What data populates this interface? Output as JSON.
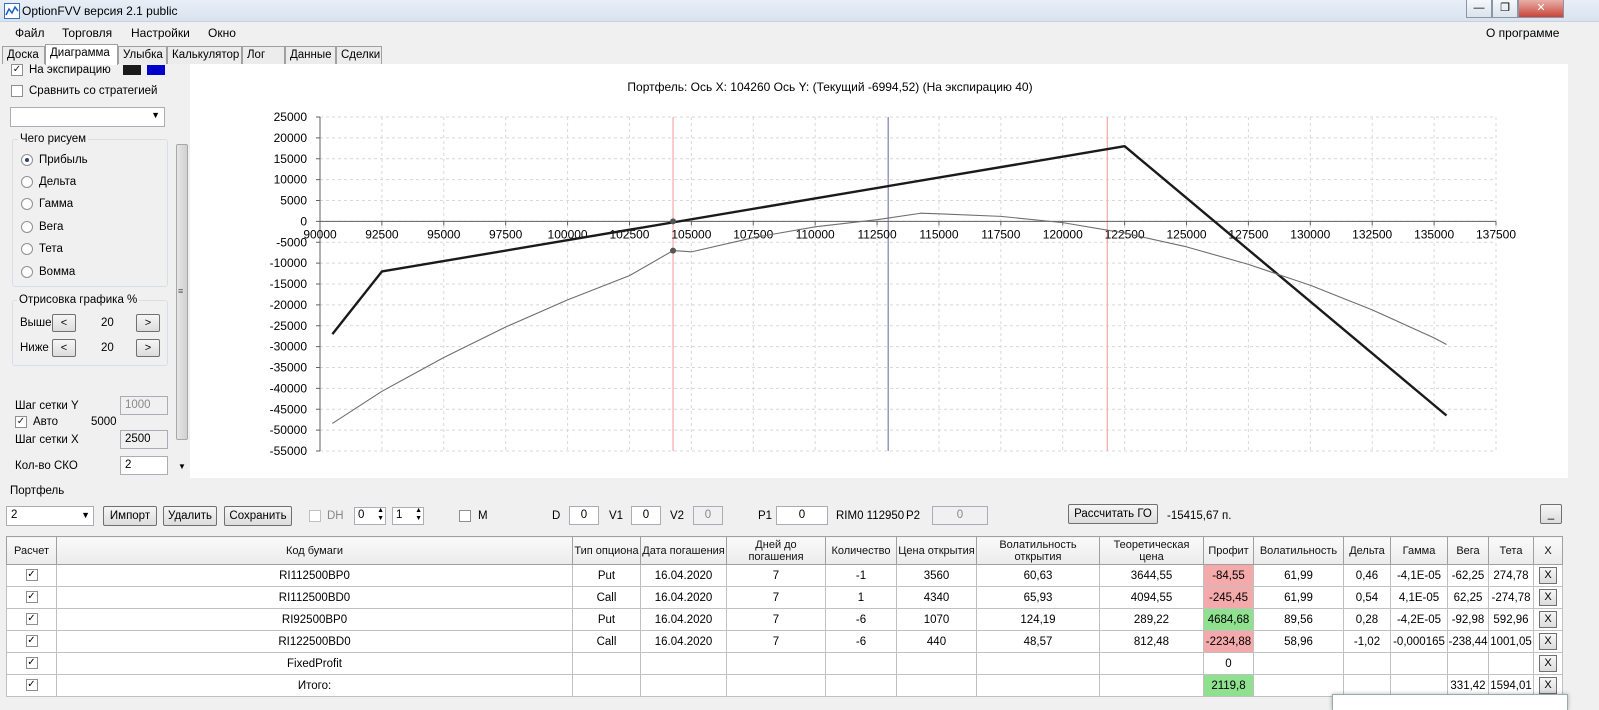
{
  "window": {
    "title": "OptionFVV версия 2.1 public"
  },
  "menu": {
    "items": [
      "Файл",
      "Торговля",
      "Настройки",
      "Окно"
    ],
    "about": "О программе"
  },
  "tabs": [
    "Доска",
    "Диаграмма",
    "Улыбка",
    "Калькулятор",
    "Лог",
    "Данные",
    "Сделки"
  ],
  "left": {
    "expiry_label": "На экспирацию",
    "compare_label": "Сравнить со стратегией",
    "what_title": "Чего рисуем",
    "radios": [
      "Прибыль",
      "Дельта",
      "Гамма",
      "Вега",
      "Тета",
      "Вомма"
    ],
    "render_title": "Отрисовка графика %",
    "above_label": "Выше",
    "above_value": "20",
    "below_label": "Ниже",
    "below_value": "20",
    "step_y_label": "Шаг сетки Y",
    "step_y_value": "1000",
    "auto_label": "Авто",
    "auto_value": "5000",
    "step_x_label": "Шаг сетки X",
    "step_x_value": "2500",
    "sko_label": "Кол-во СКО",
    "sko_value": "2",
    "swatch_colors": [
      "#1a1a1a",
      "#0000cc"
    ]
  },
  "plot": {
    "header": "Портфель:  Ось X:  104260  Ось Y:    (Текущий -6994,52)   (На экспирацию 40)"
  },
  "chart_data": {
    "type": "line",
    "x_ticks": [
      "90000",
      "92500",
      "95000",
      "97500",
      "100000",
      "102500",
      "105000",
      "107500",
      "110000",
      "112500",
      "115000",
      "117500",
      "120000",
      "122500",
      "125000",
      "127500",
      "130000",
      "132500",
      "135000",
      "137500"
    ],
    "y_ticks": [
      "25000",
      "20000",
      "15000",
      "10000",
      "5000",
      "0",
      "-5000",
      "-10000",
      "-15000",
      "-20000",
      "-25000",
      "-30000",
      "-35000",
      "-40000",
      "-45000",
      "-50000",
      "-55000"
    ],
    "xlim": [
      90000,
      137500
    ],
    "ylim": [
      -55000,
      25000
    ],
    "grid": true,
    "series": [
      {
        "role": "expiry",
        "color": "#1a1a1a",
        "x": [
          90500,
          92500,
          122500,
          135500
        ],
        "y": [
          -27000,
          -12000,
          18000,
          -46500
        ]
      },
      {
        "role": "current",
        "color": "#6e6e6e",
        "x": [
          90500,
          92500,
          95000,
          97500,
          100000,
          102500,
          104260,
          105000,
          107500,
          110000,
          112500,
          114260,
          115000,
          117500,
          120000,
          122500,
          125000,
          127500,
          130000,
          132500,
          135000,
          135500
        ],
        "y": [
          -48400,
          -40700,
          -32600,
          -25300,
          -18800,
          -13000,
          -7000,
          -7300,
          -3900,
          -1300,
          400,
          1950,
          1800,
          1200,
          -300,
          -2800,
          -6100,
          -10300,
          -15300,
          -21200,
          -27900,
          -29500
        ]
      }
    ],
    "markers": [
      {
        "x": 104260,
        "y": 0
      },
      {
        "x": 104260,
        "y": -7000
      }
    ],
    "vlines": [
      {
        "x": 104260,
        "color": "#f4a8a8"
      },
      {
        "x": 112950,
        "color": "#8080b0"
      },
      {
        "x": 121800,
        "color": "#f4a8a8"
      }
    ]
  },
  "portfolio": {
    "group_label": "Портфель",
    "select_value": "2",
    "import_label": "Импорт",
    "delete_label": "Удалить",
    "save_label": "Сохранить",
    "dh_label": "DH",
    "spin1": "0",
    "spin2": "1",
    "m_label": "M",
    "d_label": "D",
    "d_value": "0",
    "v1_label": "V1",
    "v1_value": "0",
    "v2_label": "V2",
    "v2_value": "0",
    "p1_label": "P1",
    "p1_value": "0",
    "rim_label": "RIM0 112950",
    "p2_label": "P2",
    "p2_value": "0",
    "calc_label": "Рассчитать ГО",
    "go_value": "-15415,67 п.",
    "min_label": "_"
  },
  "table": {
    "headers": [
      "Расчет",
      "Код бумаги",
      "Тип опциона",
      "Дата погашения",
      "Дней до погашения",
      "Количество",
      "Цена открытия",
      "Волатильность открытия",
      "Теоретическая цена",
      "Профит",
      "Волатильность",
      "Дельта",
      "Гамма",
      "Вега",
      "Тета",
      "X"
    ],
    "rows": [
      {
        "code": "RI112500BP0",
        "type": "Put",
        "date": "16.04.2020",
        "days": "7",
        "qty": "-1",
        "price": "3560",
        "vol_open": "60,63",
        "theo": "3644,55",
        "profit": "-84,55",
        "profit_color": "red",
        "vol": "61,99",
        "delta": "0,46",
        "gamma": "-4,1E-05",
        "vega": "-62,25",
        "theta": "274,78",
        "x": "X"
      },
      {
        "code": "RI112500BD0",
        "type": "Call",
        "date": "16.04.2020",
        "days": "7",
        "qty": "1",
        "price": "4340",
        "vol_open": "65,93",
        "theo": "4094,55",
        "profit": "-245,45",
        "profit_color": "red",
        "vol": "61,99",
        "delta": "0,54",
        "gamma": "4,1E-05",
        "vega": "62,25",
        "theta": "-274,78",
        "x": "X"
      },
      {
        "code": "RI92500BP0",
        "type": "Put",
        "date": "16.04.2020",
        "days": "7",
        "qty": "-6",
        "price": "1070",
        "vol_open": "124,19",
        "theo": "289,22",
        "profit": "4684,68",
        "profit_color": "green",
        "vol": "89,56",
        "delta": "0,28",
        "gamma": "-4,2E-05",
        "vega": "-92,98",
        "theta": "592,96",
        "x": "X"
      },
      {
        "code": "RI122500BD0",
        "type": "Call",
        "date": "16.04.2020",
        "days": "7",
        "qty": "-6",
        "price": "440",
        "vol_open": "48,57",
        "theo": "812,48",
        "profit": "-2234,88",
        "profit_color": "red",
        "vol": "58,96",
        "delta": "-1,02",
        "gamma": "-0,000165",
        "vega": "-238,44",
        "theta": "1001,05",
        "x": "X"
      },
      {
        "code": "FixedProfit",
        "type": "",
        "date": "",
        "days": "",
        "qty": "",
        "price": "",
        "vol_open": "",
        "theo": "",
        "profit": "0",
        "profit_color": "",
        "vol": "",
        "delta": "",
        "gamma": "",
        "vega": "",
        "theta": "",
        "x": "X"
      },
      {
        "code": "Итого:",
        "type": "",
        "date": "",
        "days": "",
        "qty": "",
        "price": "",
        "vol_open": "",
        "theo": "",
        "profit": "2119,8",
        "profit_color": "green",
        "vol": "",
        "delta": "",
        "gamma": "",
        "vega": "331,42",
        "theta": "1594,01",
        "x": "X"
      }
    ]
  }
}
